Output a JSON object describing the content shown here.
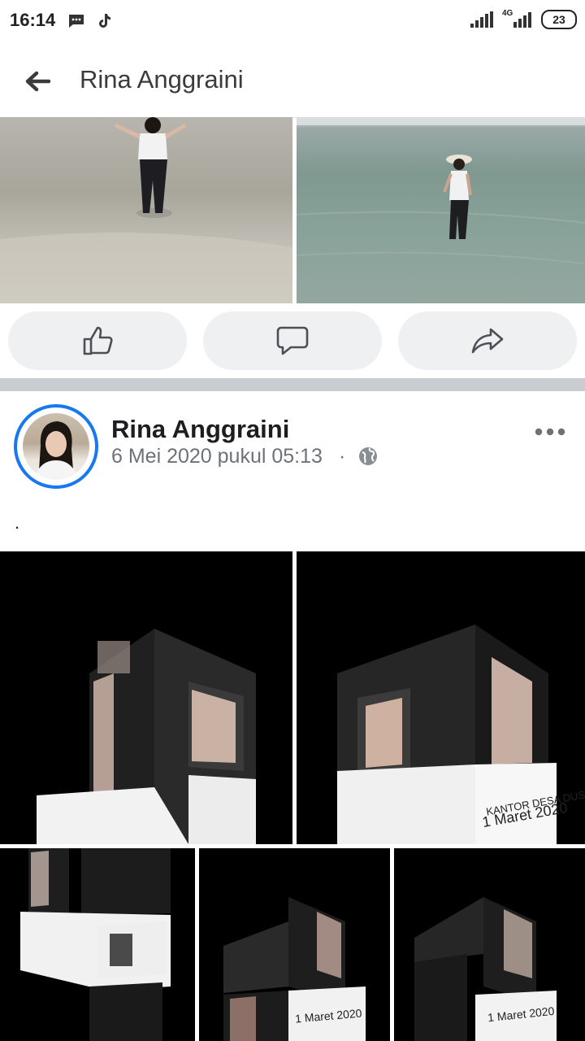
{
  "status_bar": {
    "time": "16:14",
    "network": "4G",
    "battery": "23"
  },
  "header": {
    "title": "Rina Anggraini"
  },
  "post": {
    "author": "Rina Anggraini",
    "timestamp": "6 Mei 2020 pukul 05:13",
    "separator": "·",
    "text": "."
  },
  "video_overlays": {
    "v2_date": "1 Maret 2020",
    "v2_channel": "KANTOR DESA DUSUN GULIAN",
    "v5_date": "1 Maret 2020",
    "v4_date": "1 Maret 2020"
  },
  "colors": {
    "accent": "#1877f2",
    "action_bg": "#eff0f2",
    "divider": "#c9ccd1"
  },
  "icons": [
    "back-arrow-icon",
    "like-icon",
    "comment-icon",
    "share-icon",
    "globe-icon",
    "more-icon",
    "message-icon",
    "tiktok-icon",
    "signal-icon",
    "battery-icon"
  ]
}
